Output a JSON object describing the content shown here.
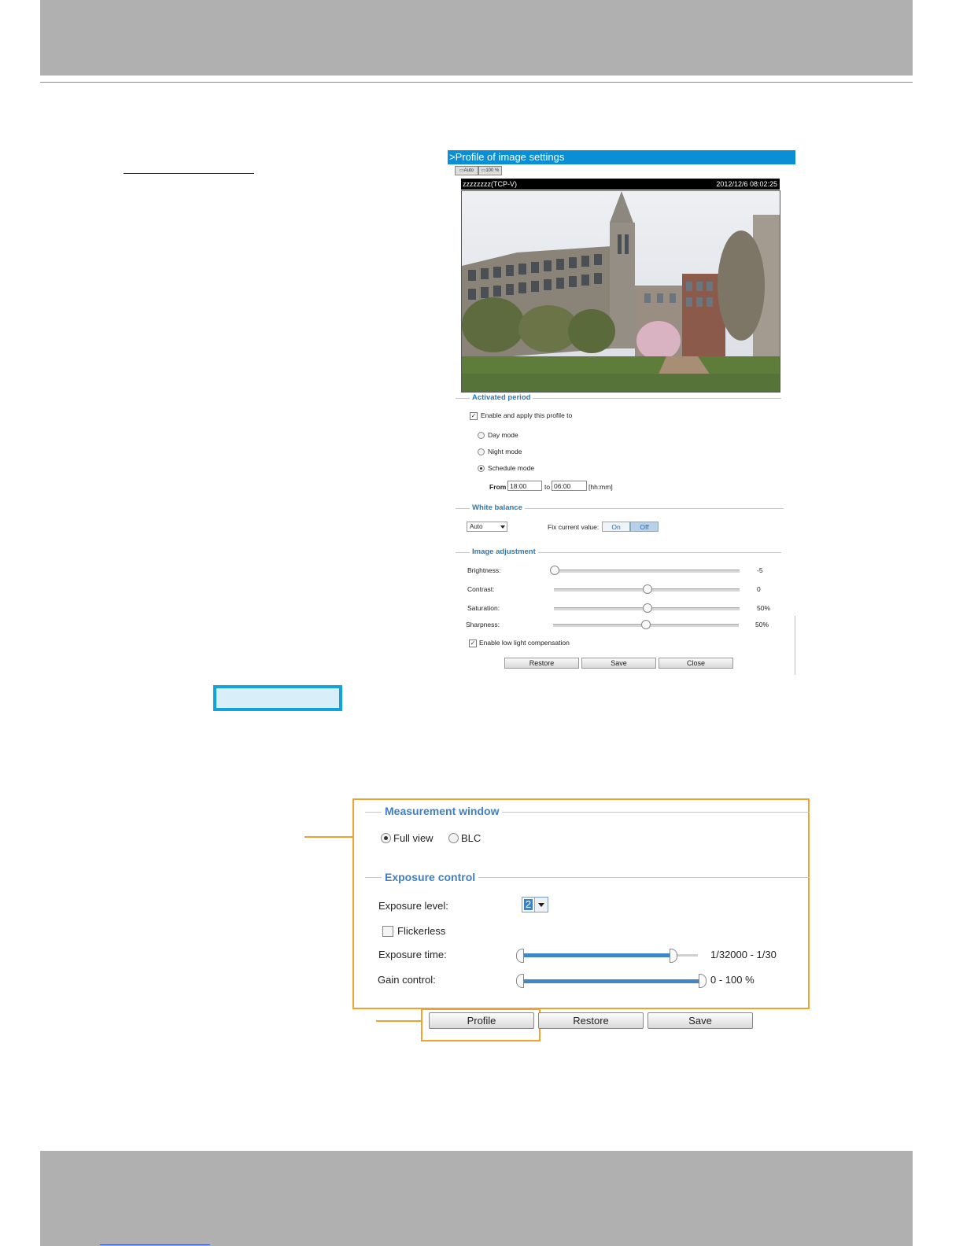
{
  "profile_panel": {
    "title": ">Profile of image settings",
    "mini_buttons": [
      "Auto",
      "100 %"
    ],
    "video": {
      "camera_name": "zzzzzzzz(TCP-V)",
      "timestamp": "2012/12/6 08:02:25"
    },
    "activated_period": {
      "title": "Activated period",
      "enable_label": "Enable and apply this profile to",
      "modes": [
        "Day mode",
        "Night mode",
        "Schedule mode"
      ],
      "selected_mode": "Schedule mode",
      "from_label": "From",
      "from_value": "18:00",
      "to_label": "to",
      "to_value": "06:00",
      "format_label": "[hh:mm]"
    },
    "white_balance": {
      "title": "White balance",
      "selected": "Auto",
      "fix_label": "Fix current value:",
      "on_label": "On",
      "off_label": "Off"
    },
    "image_adjustment": {
      "title": "Image adjustment",
      "sliders": [
        {
          "label": "Brightness:",
          "value": "-5"
        },
        {
          "label": "Contrast:",
          "value": "0"
        },
        {
          "label": "Saturation:",
          "value": "50%"
        },
        {
          "label": "Sharpness:",
          "value": "50%"
        }
      ],
      "low_light_label": "Enable low light compensation"
    },
    "buttons": {
      "restore": "Restore",
      "save": "Save",
      "close": "Close"
    }
  },
  "exposure_panel": {
    "measurement_window": {
      "title": "Measurement window",
      "options": [
        "Full view",
        "BLC"
      ],
      "selected": "Full view"
    },
    "exposure_control": {
      "title": "Exposure control",
      "level_label": "Exposure level:",
      "level_value": "2",
      "flickerless_label": "Flickerless",
      "time_label": "Exposure time:",
      "time_value": "1/32000 - 1/30",
      "gain_label": "Gain control:",
      "gain_value": "0 - 100 %"
    },
    "buttons": {
      "profile": "Profile",
      "restore": "Restore",
      "save": "Save"
    }
  }
}
